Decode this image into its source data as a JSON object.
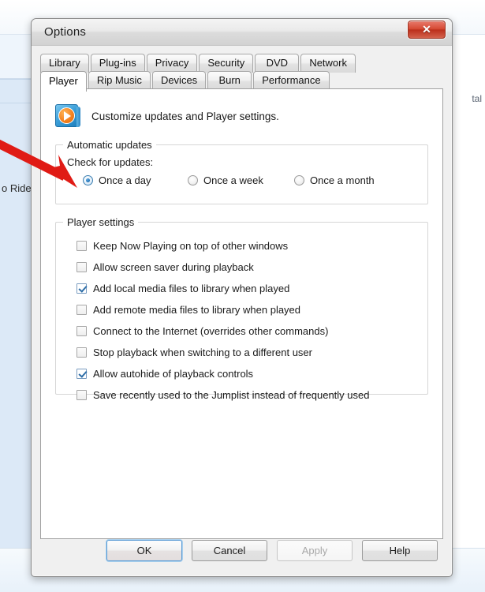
{
  "background": {
    "left_text": "o Ride",
    "right_text": "tal"
  },
  "dialog": {
    "title": "Options",
    "close_label": "✕",
    "tabs_row_top": [
      {
        "label": "Library",
        "active": false
      },
      {
        "label": "Plug-ins",
        "active": false
      },
      {
        "label": "Privacy",
        "active": false
      },
      {
        "label": "Security",
        "active": false
      },
      {
        "label": "DVD",
        "active": false
      },
      {
        "label": "Network",
        "active": false
      }
    ],
    "tabs_row_bottom": [
      {
        "label": "Player",
        "active": true
      },
      {
        "label": "Rip Music",
        "active": false
      },
      {
        "label": "Devices",
        "active": false
      },
      {
        "label": "Burn",
        "active": false
      },
      {
        "label": "Performance",
        "active": false
      }
    ],
    "panel": {
      "header_text": "Customize updates and Player settings.",
      "header_icon": "windows-media-player-icon",
      "automatic_updates": {
        "legend": "Automatic updates",
        "sub_label": "Check for updates:",
        "options": [
          {
            "label": "Once a day",
            "selected": true
          },
          {
            "label": "Once a week",
            "selected": false
          },
          {
            "label": "Once a month",
            "selected": false
          }
        ]
      },
      "player_settings": {
        "legend": "Player settings",
        "items": [
          {
            "label": "Keep Now Playing on top of other windows",
            "checked": false
          },
          {
            "label": "Allow screen saver during playback",
            "checked": false
          },
          {
            "label": "Add local media files to library when played",
            "checked": true
          },
          {
            "label": "Add remote media files to library when played",
            "checked": false
          },
          {
            "label": "Connect to the Internet (overrides other commands)",
            "checked": false
          },
          {
            "label": "Stop playback when switching to a different user",
            "checked": false
          },
          {
            "label": "Allow autohide of playback controls",
            "checked": true
          },
          {
            "label": "Save recently used to the Jumplist instead of frequently used",
            "checked": false
          }
        ]
      }
    },
    "buttons": [
      {
        "label": "OK",
        "state": "default"
      },
      {
        "label": "Cancel",
        "state": "normal"
      },
      {
        "label": "Apply",
        "state": "disabled"
      },
      {
        "label": "Help",
        "state": "normal"
      }
    ]
  },
  "annotation": {
    "arrow_color": "#e01b15",
    "arrow_name": "red-pointer-arrow"
  }
}
